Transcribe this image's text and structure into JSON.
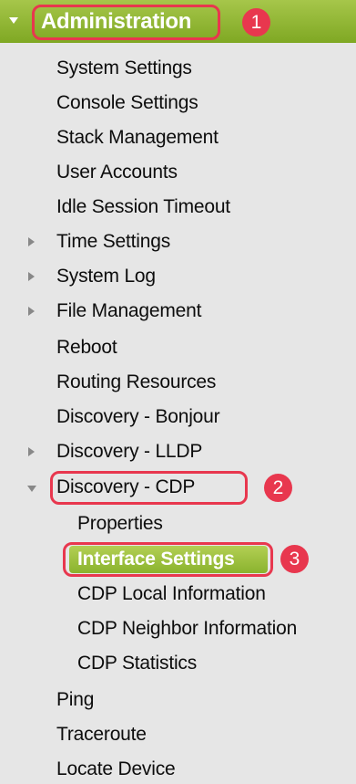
{
  "nav": {
    "header": {
      "label": "Administration",
      "badge": "1"
    },
    "items": [
      {
        "label": "System Settings"
      },
      {
        "label": "Console Settings"
      },
      {
        "label": "Stack Management"
      },
      {
        "label": "User Accounts"
      },
      {
        "label": "Idle Session Timeout"
      },
      {
        "label": "Time Settings",
        "expander": "collapsed"
      },
      {
        "label": "System Log",
        "expander": "collapsed"
      },
      {
        "label": "File Management",
        "expander": "collapsed"
      },
      {
        "label": "Reboot"
      },
      {
        "label": "Routing Resources"
      },
      {
        "label": "Discovery - Bonjour"
      },
      {
        "label": "Discovery - LLDP",
        "expander": "collapsed"
      },
      {
        "label": "Discovery - CDP",
        "expander": "expanded",
        "badge": "2",
        "children": [
          {
            "label": "Properties"
          },
          {
            "label": "Interface Settings",
            "selected": true,
            "badge": "3"
          },
          {
            "label": "CDP Local Information"
          },
          {
            "label": "CDP Neighbor Information"
          },
          {
            "label": "CDP Statistics"
          }
        ]
      },
      {
        "label": "Ping"
      },
      {
        "label": "Traceroute"
      },
      {
        "label": "Locate Device"
      }
    ]
  },
  "colors": {
    "accent_green": "#8ab32e",
    "annotation_red": "#e8374e",
    "nav_background": "#e6e6e6"
  }
}
